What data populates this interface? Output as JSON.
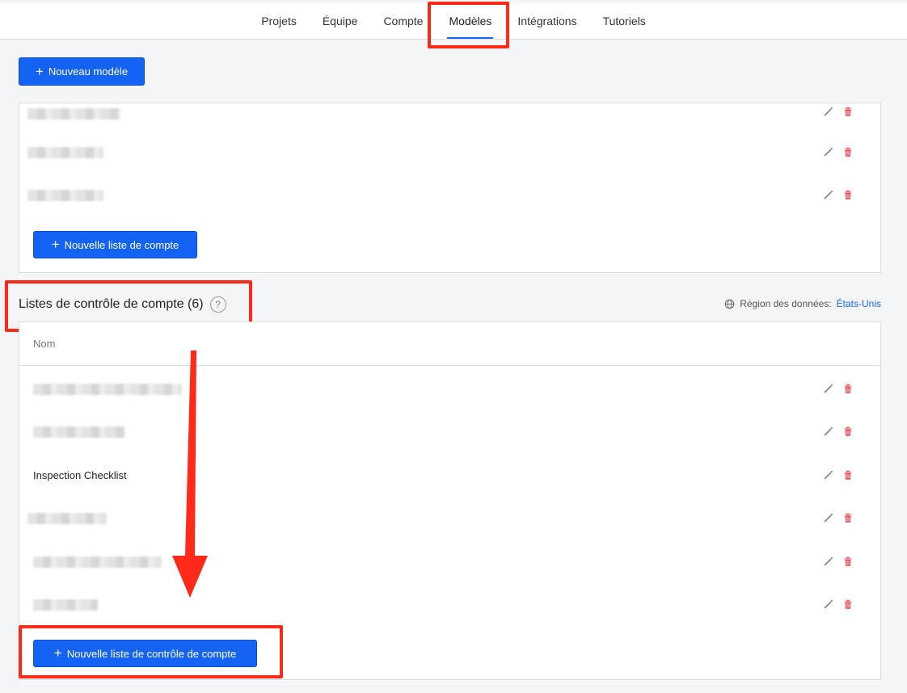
{
  "nav": {
    "tabs": [
      {
        "label": "Projets"
      },
      {
        "label": "Équipe"
      },
      {
        "label": "Compte"
      },
      {
        "label": "Modèles",
        "active": true
      },
      {
        "label": "Intégrations"
      },
      {
        "label": "Tutoriels"
      }
    ]
  },
  "toolbar": {
    "new_template_label": "Nouveau modèle"
  },
  "account_lists_panel": {
    "new_list_label": "Nouvelle liste de compte"
  },
  "checklists_section": {
    "title": "Listes de contrôle de compte (6)",
    "help_glyph": "?",
    "region_label": "Région des données:",
    "region_value": "États-Unis",
    "column_name": "Nom",
    "rows": [
      {
        "label": ""
      },
      {
        "label": ""
      },
      {
        "label": "Inspection Checklist"
      },
      {
        "label": ""
      },
      {
        "label": ""
      },
      {
        "label": ""
      }
    ],
    "new_checklist_label": "Nouvelle liste de contrôle de compte"
  },
  "colors": {
    "primary": "#1463f3",
    "highlight": "#ff2a1a",
    "delete": "#e8434f",
    "link": "#1a66ff"
  }
}
